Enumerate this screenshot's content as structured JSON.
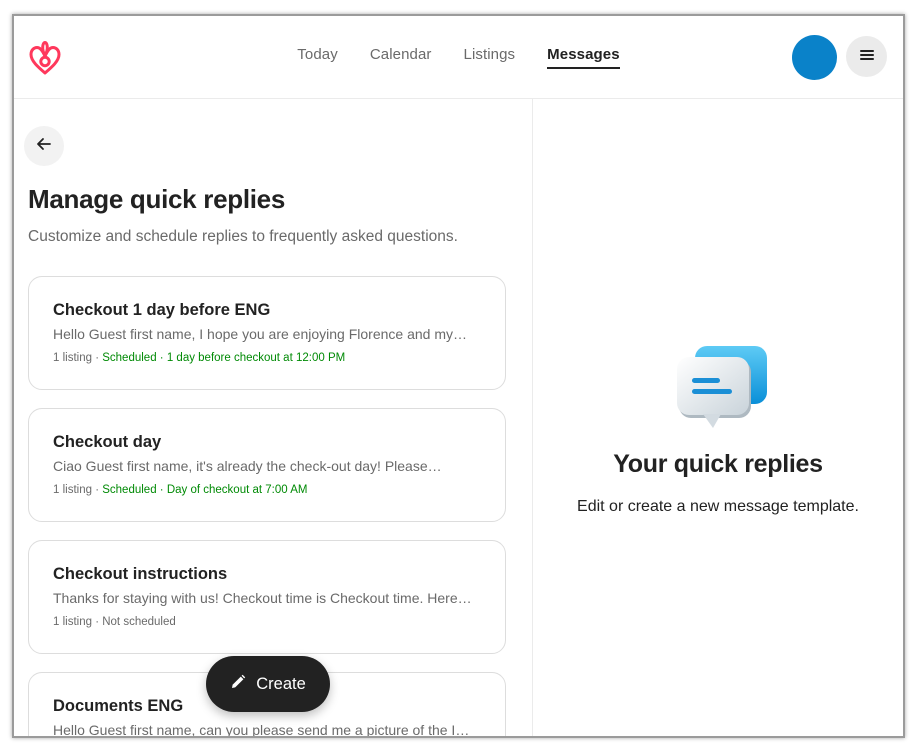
{
  "nav": {
    "items": [
      {
        "label": "Today"
      },
      {
        "label": "Calendar"
      },
      {
        "label": "Listings"
      },
      {
        "label": "Messages"
      }
    ],
    "active": "Messages"
  },
  "colors": {
    "brand": "#ff385c",
    "avatar": "#0a82c9",
    "scheduled": "#008a05"
  },
  "icons": {
    "logo": "airbnb-logo-icon",
    "menu": "hamburger-menu-icon",
    "back": "arrow-left-icon",
    "create": "pencil-icon",
    "illustration": "chat-bubbles-icon"
  },
  "page": {
    "title": "Manage quick replies",
    "subtitle": "Customize and schedule replies to frequently asked questions."
  },
  "replies": [
    {
      "title": "Checkout 1 day before ENG",
      "preview": "Hello Guest first name, I hope you are enjoying Florence and my…",
      "listings": "1 listing",
      "separator": " · ",
      "status": "Scheduled",
      "schedule": "1 day before checkout at 12:00 PM"
    },
    {
      "title": "Checkout day",
      "preview": "Ciao Guest first name, it's already the check-out day! Please…",
      "listings": "1 listing",
      "separator": " · ",
      "status": "Scheduled",
      "schedule": "Day of checkout at 7:00 AM"
    },
    {
      "title": "Checkout instructions",
      "preview": "Thanks for staying with us! Checkout time is Checkout time. Here…",
      "listings": "1 listing",
      "separator": " · ",
      "status": "Not scheduled"
    },
    {
      "title": "Documents ENG",
      "preview": "Hello Guest first name, can you please send me a picture of the I…"
    }
  ],
  "create_button": {
    "label": "Create"
  },
  "empty_state": {
    "title": "Your quick replies",
    "subtitle": "Edit or create a new message template."
  }
}
